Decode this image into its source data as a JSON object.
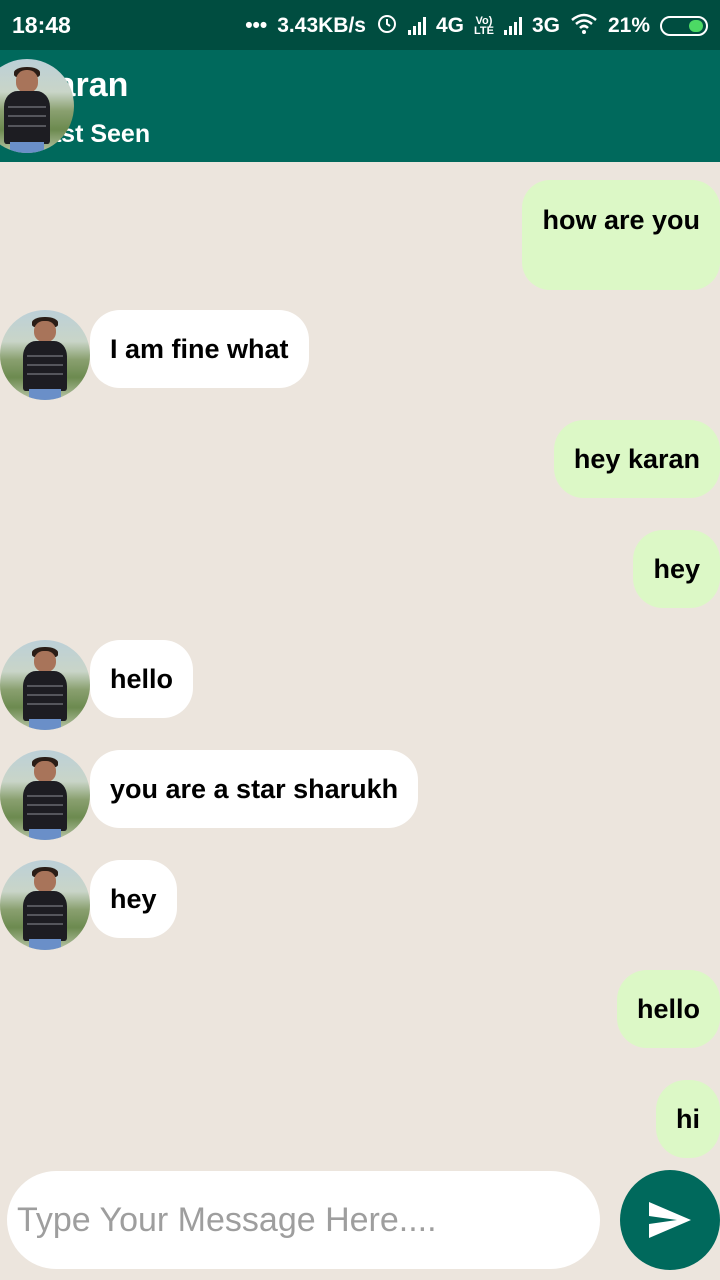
{
  "status_bar": {
    "time": "18:48",
    "dots": "•••",
    "speed": "3.43KB/s",
    "net1": "4G",
    "volte_top": "Vo)",
    "volte_bottom": "LTE",
    "net2": "3G",
    "battery": "21%",
    "icons": [
      "alarm-icon",
      "signal-icon",
      "wifi-icon",
      "battery-charging-icon"
    ]
  },
  "header": {
    "name": "Karan",
    "status": "Last Seen"
  },
  "messages": [
    {
      "dir": "out",
      "text": "how are you"
    },
    {
      "dir": "in",
      "text": "I am fine what"
    },
    {
      "dir": "out",
      "text": "hey karan"
    },
    {
      "dir": "out",
      "text": "hey"
    },
    {
      "dir": "in",
      "text": "hello"
    },
    {
      "dir": "in",
      "text": "you are a star sharukh"
    },
    {
      "dir": "in",
      "text": "hey"
    },
    {
      "dir": "out",
      "text": "hello"
    },
    {
      "dir": "out",
      "text": "hi"
    }
  ],
  "composer": {
    "placeholder": "Type Your Message Here....",
    "send_icon": "send-icon"
  },
  "colors": {
    "status_bar": "#004d40",
    "app_bar": "#00695c",
    "background": "#ece5dd",
    "outgoing_bubble": "#dcf8c6",
    "incoming_bubble": "#ffffff"
  }
}
